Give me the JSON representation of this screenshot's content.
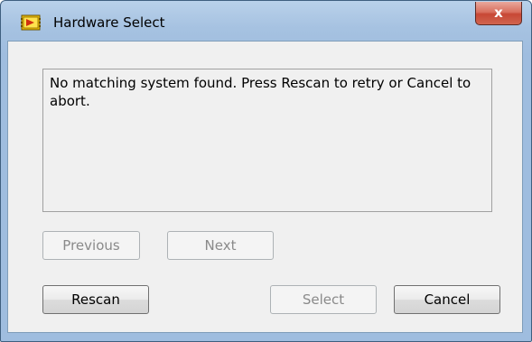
{
  "window": {
    "title": "Hardware Select",
    "close_symbol": "x",
    "icon": "labview-app-icon"
  },
  "message": {
    "text": "No matching system found. Press Rescan to retry or Cancel to abort."
  },
  "buttons": {
    "previous": {
      "label": "Previous",
      "enabled": false
    },
    "next": {
      "label": "Next",
      "enabled": false
    },
    "rescan": {
      "label": "Rescan",
      "enabled": true
    },
    "select": {
      "label": "Select",
      "enabled": false
    },
    "cancel": {
      "label": "Cancel",
      "enabled": true
    }
  },
  "colors": {
    "title_bar": "#a6c2e1",
    "close_button": "#c74735",
    "client_background": "#f0f0f0",
    "disabled_text": "#8a8a8a"
  }
}
